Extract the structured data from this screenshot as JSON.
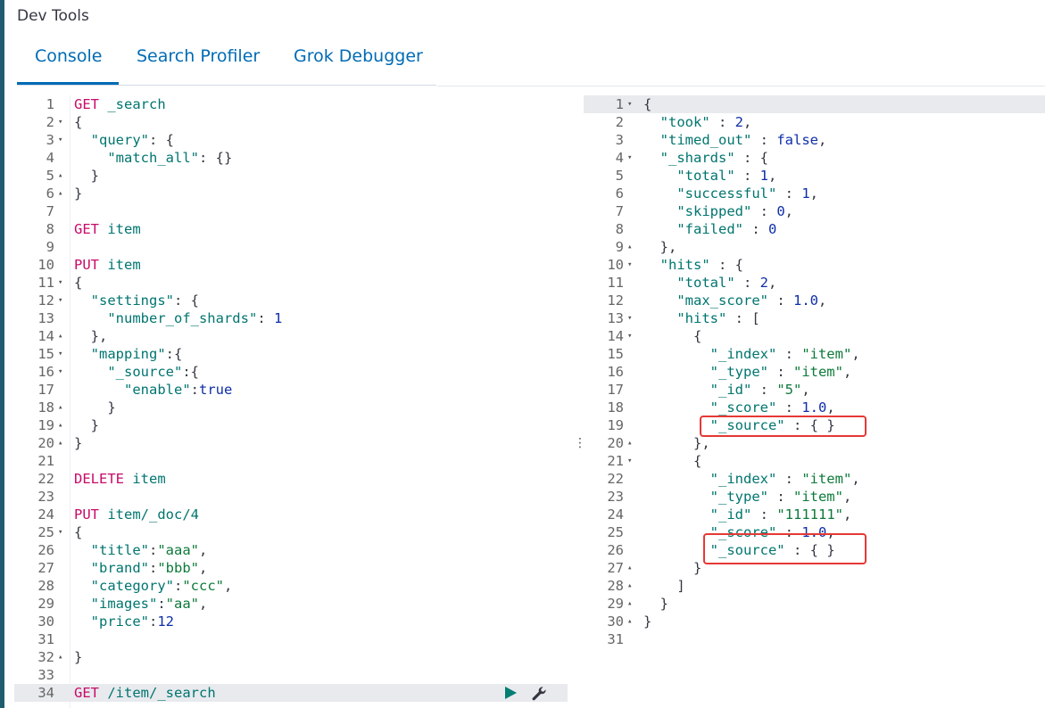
{
  "app": {
    "title": "Dev Tools"
  },
  "tabs": [
    {
      "label": "Console"
    },
    {
      "label": "Search Profiler"
    },
    {
      "label": "Grok Debugger"
    }
  ],
  "colors": {
    "accent": "#006bb4",
    "method": "#c80a68",
    "key": "#00756f",
    "annotation": "#e53935"
  },
  "icons": {
    "run": "play-icon",
    "settings": "wrench-icon",
    "resize": "vertical-ellipsis-icon"
  },
  "request_editor": {
    "lines": [
      {
        "n": "1",
        "fold": "",
        "parts": [
          [
            "method",
            "GET"
          ],
          [
            "punc",
            " "
          ],
          [
            "url",
            "_search"
          ]
        ]
      },
      {
        "n": "2",
        "fold": "▾",
        "parts": [
          [
            "punc",
            "{"
          ]
        ]
      },
      {
        "n": "3",
        "fold": "▾",
        "parts": [
          [
            "punc",
            "  "
          ],
          [
            "key",
            "\"query\""
          ],
          [
            "punc",
            ": {"
          ]
        ]
      },
      {
        "n": "4",
        "fold": "",
        "parts": [
          [
            "punc",
            "    "
          ],
          [
            "key",
            "\"match_all\""
          ],
          [
            "punc",
            ": {}"
          ]
        ]
      },
      {
        "n": "5",
        "fold": "▴",
        "parts": [
          [
            "punc",
            "  }"
          ]
        ]
      },
      {
        "n": "6",
        "fold": "▴",
        "parts": [
          [
            "punc",
            "}"
          ]
        ]
      },
      {
        "n": "7",
        "fold": "",
        "parts": []
      },
      {
        "n": "8",
        "fold": "",
        "parts": [
          [
            "method",
            "GET"
          ],
          [
            "punc",
            " "
          ],
          [
            "url",
            "item"
          ]
        ]
      },
      {
        "n": "9",
        "fold": "",
        "parts": []
      },
      {
        "n": "10",
        "fold": "",
        "parts": [
          [
            "method",
            "PUT"
          ],
          [
            "punc",
            " "
          ],
          [
            "url",
            "item"
          ]
        ]
      },
      {
        "n": "11",
        "fold": "▾",
        "parts": [
          [
            "punc",
            "{"
          ]
        ]
      },
      {
        "n": "12",
        "fold": "▾",
        "parts": [
          [
            "punc",
            "  "
          ],
          [
            "key",
            "\"settings\""
          ],
          [
            "punc",
            ": {"
          ]
        ]
      },
      {
        "n": "13",
        "fold": "",
        "parts": [
          [
            "punc",
            "    "
          ],
          [
            "key",
            "\"number_of_shards\""
          ],
          [
            "punc",
            ": "
          ],
          [
            "num",
            "1"
          ]
        ]
      },
      {
        "n": "14",
        "fold": "▴",
        "parts": [
          [
            "punc",
            "  },"
          ]
        ]
      },
      {
        "n": "15",
        "fold": "▾",
        "parts": [
          [
            "punc",
            "  "
          ],
          [
            "key",
            "\"mapping\""
          ],
          [
            "punc",
            ":{"
          ]
        ]
      },
      {
        "n": "16",
        "fold": "▾",
        "parts": [
          [
            "punc",
            "    "
          ],
          [
            "key",
            "\"_source\""
          ],
          [
            "punc",
            ":{"
          ]
        ]
      },
      {
        "n": "17",
        "fold": "",
        "parts": [
          [
            "punc",
            "      "
          ],
          [
            "key",
            "\"enable\""
          ],
          [
            "punc",
            ":"
          ],
          [
            "bool",
            "true"
          ]
        ]
      },
      {
        "n": "18",
        "fold": "▴",
        "parts": [
          [
            "punc",
            "    }"
          ]
        ]
      },
      {
        "n": "19",
        "fold": "▴",
        "parts": [
          [
            "punc",
            "  }"
          ]
        ]
      },
      {
        "n": "20",
        "fold": "▴",
        "parts": [
          [
            "punc",
            "}"
          ]
        ]
      },
      {
        "n": "21",
        "fold": "",
        "parts": []
      },
      {
        "n": "22",
        "fold": "",
        "parts": [
          [
            "method",
            "DELETE"
          ],
          [
            "punc",
            " "
          ],
          [
            "url",
            "item"
          ]
        ]
      },
      {
        "n": "23",
        "fold": "",
        "parts": []
      },
      {
        "n": "24",
        "fold": "",
        "parts": [
          [
            "method",
            "PUT"
          ],
          [
            "punc",
            " "
          ],
          [
            "url",
            "item/_doc/4"
          ]
        ]
      },
      {
        "n": "25",
        "fold": "▾",
        "parts": [
          [
            "punc",
            "{"
          ]
        ]
      },
      {
        "n": "26",
        "fold": "",
        "parts": [
          [
            "punc",
            "  "
          ],
          [
            "key",
            "\"title\""
          ],
          [
            "punc",
            ":"
          ],
          [
            "str",
            "\"aaa\""
          ],
          [
            "punc",
            ","
          ]
        ]
      },
      {
        "n": "27",
        "fold": "",
        "parts": [
          [
            "punc",
            "  "
          ],
          [
            "key",
            "\"brand\""
          ],
          [
            "punc",
            ":"
          ],
          [
            "str",
            "\"bbb\""
          ],
          [
            "punc",
            ","
          ]
        ]
      },
      {
        "n": "28",
        "fold": "",
        "parts": [
          [
            "punc",
            "  "
          ],
          [
            "key",
            "\"category\""
          ],
          [
            "punc",
            ":"
          ],
          [
            "str",
            "\"ccc\""
          ],
          [
            "punc",
            ","
          ]
        ]
      },
      {
        "n": "29",
        "fold": "",
        "parts": [
          [
            "punc",
            "  "
          ],
          [
            "key",
            "\"images\""
          ],
          [
            "punc",
            ":"
          ],
          [
            "str",
            "\"aa\""
          ],
          [
            "punc",
            ","
          ]
        ]
      },
      {
        "n": "30",
        "fold": "",
        "parts": [
          [
            "punc",
            "  "
          ],
          [
            "key",
            "\"price\""
          ],
          [
            "punc",
            ":"
          ],
          [
            "num",
            "12"
          ]
        ]
      },
      {
        "n": "31",
        "fold": "",
        "parts": []
      },
      {
        "n": "32",
        "fold": "▴",
        "parts": [
          [
            "punc",
            "}"
          ]
        ]
      },
      {
        "n": "33",
        "fold": "",
        "parts": []
      },
      {
        "n": "34",
        "fold": "",
        "parts": [
          [
            "method",
            "GET"
          ],
          [
            "punc",
            " "
          ],
          [
            "url",
            "/item/_search"
          ]
        ],
        "current": true
      }
    ]
  },
  "response_viewer": {
    "lines": [
      {
        "n": "1",
        "fold": "▾",
        "parts": [
          [
            "punc",
            "{"
          ]
        ],
        "current": true
      },
      {
        "n": "2",
        "fold": "",
        "parts": [
          [
            "punc",
            "  "
          ],
          [
            "rkey",
            "\"took\""
          ],
          [
            "punc",
            " : "
          ],
          [
            "num",
            "2"
          ],
          [
            "punc",
            ","
          ]
        ]
      },
      {
        "n": "3",
        "fold": "",
        "parts": [
          [
            "punc",
            "  "
          ],
          [
            "rkey",
            "\"timed_out\""
          ],
          [
            "punc",
            " : "
          ],
          [
            "bool",
            "false"
          ],
          [
            "punc",
            ","
          ]
        ]
      },
      {
        "n": "4",
        "fold": "▾",
        "parts": [
          [
            "punc",
            "  "
          ],
          [
            "rkey",
            "\"_shards\""
          ],
          [
            "punc",
            " : {"
          ]
        ]
      },
      {
        "n": "5",
        "fold": "",
        "parts": [
          [
            "punc",
            "    "
          ],
          [
            "rkey",
            "\"total\""
          ],
          [
            "punc",
            " : "
          ],
          [
            "num",
            "1"
          ],
          [
            "punc",
            ","
          ]
        ]
      },
      {
        "n": "6",
        "fold": "",
        "parts": [
          [
            "punc",
            "    "
          ],
          [
            "rkey",
            "\"successful\""
          ],
          [
            "punc",
            " : "
          ],
          [
            "num",
            "1"
          ],
          [
            "punc",
            ","
          ]
        ]
      },
      {
        "n": "7",
        "fold": "",
        "parts": [
          [
            "punc",
            "    "
          ],
          [
            "rkey",
            "\"skipped\""
          ],
          [
            "punc",
            " : "
          ],
          [
            "num",
            "0"
          ],
          [
            "punc",
            ","
          ]
        ]
      },
      {
        "n": "8",
        "fold": "",
        "parts": [
          [
            "punc",
            "    "
          ],
          [
            "rkey",
            "\"failed\""
          ],
          [
            "punc",
            " : "
          ],
          [
            "num",
            "0"
          ]
        ]
      },
      {
        "n": "9",
        "fold": "▴",
        "parts": [
          [
            "punc",
            "  },"
          ]
        ]
      },
      {
        "n": "10",
        "fold": "▾",
        "parts": [
          [
            "punc",
            "  "
          ],
          [
            "rkey",
            "\"hits\""
          ],
          [
            "punc",
            " : {"
          ]
        ]
      },
      {
        "n": "11",
        "fold": "",
        "parts": [
          [
            "punc",
            "    "
          ],
          [
            "rkey",
            "\"total\""
          ],
          [
            "punc",
            " : "
          ],
          [
            "num",
            "2"
          ],
          [
            "punc",
            ","
          ]
        ]
      },
      {
        "n": "12",
        "fold": "",
        "parts": [
          [
            "punc",
            "    "
          ],
          [
            "rkey",
            "\"max_score\""
          ],
          [
            "punc",
            " : "
          ],
          [
            "num",
            "1.0"
          ],
          [
            "punc",
            ","
          ]
        ]
      },
      {
        "n": "13",
        "fold": "▾",
        "parts": [
          [
            "punc",
            "    "
          ],
          [
            "rkey",
            "\"hits\""
          ],
          [
            "punc",
            " : ["
          ]
        ]
      },
      {
        "n": "14",
        "fold": "▾",
        "parts": [
          [
            "punc",
            "      {"
          ]
        ]
      },
      {
        "n": "15",
        "fold": "",
        "parts": [
          [
            "punc",
            "        "
          ],
          [
            "rkey",
            "\"_index\""
          ],
          [
            "punc",
            " : "
          ],
          [
            "rstr",
            "\"item\""
          ],
          [
            "punc",
            ","
          ]
        ]
      },
      {
        "n": "16",
        "fold": "",
        "parts": [
          [
            "punc",
            "        "
          ],
          [
            "rkey",
            "\"_type\""
          ],
          [
            "punc",
            " : "
          ],
          [
            "rstr",
            "\"item\""
          ],
          [
            "punc",
            ","
          ]
        ]
      },
      {
        "n": "17",
        "fold": "",
        "parts": [
          [
            "punc",
            "        "
          ],
          [
            "rkey",
            "\"_id\""
          ],
          [
            "punc",
            " : "
          ],
          [
            "rstr",
            "\"5\""
          ],
          [
            "punc",
            ","
          ]
        ]
      },
      {
        "n": "18",
        "fold": "",
        "parts": [
          [
            "punc",
            "        "
          ],
          [
            "rkey",
            "\"_score\""
          ],
          [
            "punc",
            " : "
          ],
          [
            "num",
            "1.0"
          ],
          [
            "punc",
            ","
          ]
        ]
      },
      {
        "n": "19",
        "fold": "",
        "parts": [
          [
            "punc",
            "        "
          ],
          [
            "rkey",
            "\"_source\""
          ],
          [
            "punc",
            " : { }"
          ]
        ]
      },
      {
        "n": "20",
        "fold": "▴",
        "parts": [
          [
            "punc",
            "      },"
          ]
        ]
      },
      {
        "n": "21",
        "fold": "▾",
        "parts": [
          [
            "punc",
            "      {"
          ]
        ]
      },
      {
        "n": "22",
        "fold": "",
        "parts": [
          [
            "punc",
            "        "
          ],
          [
            "rkey",
            "\"_index\""
          ],
          [
            "punc",
            " : "
          ],
          [
            "rstr",
            "\"item\""
          ],
          [
            "punc",
            ","
          ]
        ]
      },
      {
        "n": "23",
        "fold": "",
        "parts": [
          [
            "punc",
            "        "
          ],
          [
            "rkey",
            "\"_type\""
          ],
          [
            "punc",
            " : "
          ],
          [
            "rstr",
            "\"item\""
          ],
          [
            "punc",
            ","
          ]
        ]
      },
      {
        "n": "24",
        "fold": "",
        "parts": [
          [
            "punc",
            "        "
          ],
          [
            "rkey",
            "\"_id\""
          ],
          [
            "punc",
            " : "
          ],
          [
            "rstr",
            "\"111111\""
          ],
          [
            "punc",
            ","
          ]
        ]
      },
      {
        "n": "25",
        "fold": "",
        "parts": [
          [
            "punc",
            "        "
          ],
          [
            "rkey",
            "\"_score\""
          ],
          [
            "punc",
            " : "
          ],
          [
            "num",
            "1.0"
          ],
          [
            "punc",
            ","
          ]
        ]
      },
      {
        "n": "26",
        "fold": "",
        "parts": [
          [
            "punc",
            "        "
          ],
          [
            "rkey",
            "\"_source\""
          ],
          [
            "punc",
            " : { }"
          ]
        ]
      },
      {
        "n": "27",
        "fold": "▴",
        "parts": [
          [
            "punc",
            "      }"
          ]
        ]
      },
      {
        "n": "28",
        "fold": "▴",
        "parts": [
          [
            "punc",
            "    ]"
          ]
        ]
      },
      {
        "n": "29",
        "fold": "▴",
        "parts": [
          [
            "punc",
            "  }"
          ]
        ]
      },
      {
        "n": "30",
        "fold": "▴",
        "parts": [
          [
            "punc",
            "}"
          ]
        ]
      },
      {
        "n": "31",
        "fold": "",
        "parts": []
      }
    ]
  }
}
